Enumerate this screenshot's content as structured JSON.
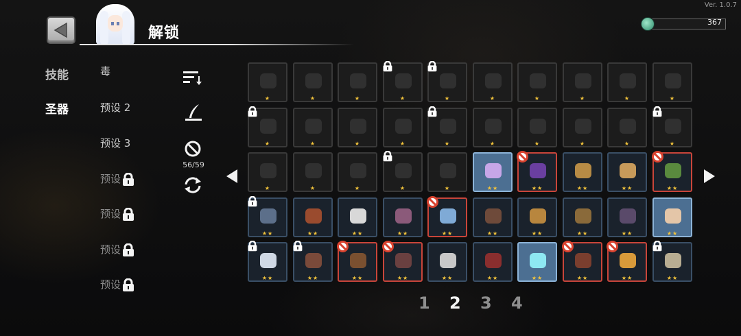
{
  "version": "Ver. 1.0.7",
  "header": {
    "title": "解锁"
  },
  "currency": {
    "value": "367"
  },
  "nav": {
    "skills": "技能",
    "relics": "圣器",
    "active": "relics"
  },
  "presets": [
    {
      "label": "毒",
      "locked": false
    },
    {
      "label": "预设 2",
      "locked": false
    },
    {
      "label": "预设 3",
      "locked": false
    },
    {
      "label": "预设",
      "locked": true
    },
    {
      "label": "预设",
      "locked": true
    },
    {
      "label": "预设",
      "locked": true
    },
    {
      "label": "预设",
      "locked": true
    }
  ],
  "tools": {
    "sort_icon": "sort-icon",
    "filter_icon": "quill-icon",
    "ban_icon": "ban-icon",
    "ban_count": "56/59",
    "refresh_icon": "refresh-icon"
  },
  "grid": {
    "rows": [
      [
        {
          "item": "helmet",
          "state": "dim",
          "stars": 1,
          "badge": ""
        },
        {
          "item": "claw",
          "state": "dim",
          "stars": 1,
          "badge": ""
        },
        {
          "item": "necklace",
          "state": "dim",
          "stars": 1,
          "badge": ""
        },
        {
          "item": "moon-orb",
          "state": "dim",
          "stars": 1,
          "badge": "lock"
        },
        {
          "item": "scroll-bag",
          "state": "dim",
          "stars": 1,
          "badge": "lock"
        },
        {
          "item": "feather-blade",
          "state": "dim",
          "stars": 1,
          "badge": ""
        },
        {
          "item": "bird",
          "state": "dim",
          "stars": 1,
          "badge": ""
        },
        {
          "item": "meat",
          "state": "dim",
          "stars": 1,
          "badge": ""
        },
        {
          "item": "spider",
          "state": "dim",
          "stars": 1,
          "badge": ""
        },
        {
          "item": "bone-arm",
          "state": "dim",
          "stars": 1,
          "badge": ""
        }
      ],
      [
        {
          "item": "quill",
          "state": "dim",
          "stars": 1,
          "badge": "lock"
        },
        {
          "item": "fur-claw",
          "state": "dim",
          "stars": 1,
          "badge": ""
        },
        {
          "item": "gauntlet",
          "state": "dim",
          "stars": 1,
          "badge": ""
        },
        {
          "item": "pan",
          "state": "dim",
          "stars": 1,
          "badge": ""
        },
        {
          "item": "headband",
          "state": "dim",
          "stars": 1,
          "badge": "lock"
        },
        {
          "item": "parchment",
          "state": "dim",
          "stars": 1,
          "badge": ""
        },
        {
          "item": "bust",
          "state": "dim",
          "stars": 1,
          "badge": ""
        },
        {
          "item": "magnet",
          "state": "dim",
          "stars": 1,
          "badge": ""
        },
        {
          "item": "arrow",
          "state": "dim",
          "stars": 1,
          "badge": ""
        },
        {
          "item": "banner",
          "state": "dim",
          "stars": 1,
          "badge": "lock"
        }
      ],
      [
        {
          "item": "heart",
          "state": "dim",
          "stars": 1,
          "badge": ""
        },
        {
          "item": "serpent",
          "state": "dim",
          "stars": 1,
          "badge": ""
        },
        {
          "item": "seed",
          "state": "dim",
          "stars": 1,
          "badge": ""
        },
        {
          "item": "bomb",
          "state": "dim",
          "stars": 1,
          "badge": "lock"
        },
        {
          "item": "bone",
          "state": "dim",
          "stars": 1,
          "badge": ""
        },
        {
          "item": "crystal",
          "state": "highlight",
          "stars": 2,
          "badge": ""
        },
        {
          "item": "tentacle",
          "state": "banned",
          "stars": 2,
          "badge": "ban"
        },
        {
          "item": "potion",
          "state": "owned",
          "stars": 2,
          "badge": ""
        },
        {
          "item": "shell",
          "state": "owned",
          "stars": 2,
          "badge": ""
        },
        {
          "item": "green-book",
          "state": "banned",
          "stars": 2,
          "badge": "ban"
        }
      ],
      [
        {
          "item": "statue",
          "state": "owned",
          "stars": 2,
          "badge": "lock"
        },
        {
          "item": "eye-orb",
          "state": "owned",
          "stars": 2,
          "badge": ""
        },
        {
          "item": "dice",
          "state": "owned",
          "stars": 2,
          "badge": ""
        },
        {
          "item": "spellbook",
          "state": "owned",
          "stars": 2,
          "badge": ""
        },
        {
          "item": "leaves",
          "state": "banned",
          "stars": 2,
          "badge": "ban"
        },
        {
          "item": "armor",
          "state": "owned",
          "stars": 2,
          "badge": ""
        },
        {
          "item": "cookie",
          "state": "owned",
          "stars": 2,
          "badge": ""
        },
        {
          "item": "sword",
          "state": "owned",
          "stars": 2,
          "badge": ""
        },
        {
          "item": "dark-blade",
          "state": "owned",
          "stars": 2,
          "badge": ""
        },
        {
          "item": "scarecrow",
          "state": "highlight",
          "stars": 2,
          "badge": ""
        }
      ],
      [
        {
          "item": "snowflake",
          "state": "owned",
          "stars": 2,
          "badge": "lock"
        },
        {
          "item": "barrel",
          "state": "owned",
          "stars": 2,
          "badge": "lock"
        },
        {
          "item": "glove",
          "state": "banned",
          "stars": 2,
          "badge": "ban"
        },
        {
          "item": "pod",
          "state": "banned",
          "stars": 2,
          "badge": "ban"
        },
        {
          "item": "skull-staff",
          "state": "owned",
          "stars": 2,
          "badge": ""
        },
        {
          "item": "red-cloth",
          "state": "owned",
          "stars": 2,
          "badge": ""
        },
        {
          "item": "mirror",
          "state": "highlight",
          "stars": 2,
          "badge": ""
        },
        {
          "item": "steak",
          "state": "banned",
          "stars": 2,
          "badge": "ban"
        },
        {
          "item": "drill",
          "state": "banned",
          "stars": 2,
          "badge": "ban"
        },
        {
          "item": "map",
          "state": "owned",
          "stars": 2,
          "badge": "lock"
        }
      ]
    ]
  },
  "pages": [
    "1",
    "2",
    "3",
    "4"
  ],
  "current_page": "2",
  "colors": {
    "star": "#f3c43b",
    "ban": "#d9432f",
    "highlight_bg": "#4c6f92",
    "owned_border": "#3a4f66"
  }
}
